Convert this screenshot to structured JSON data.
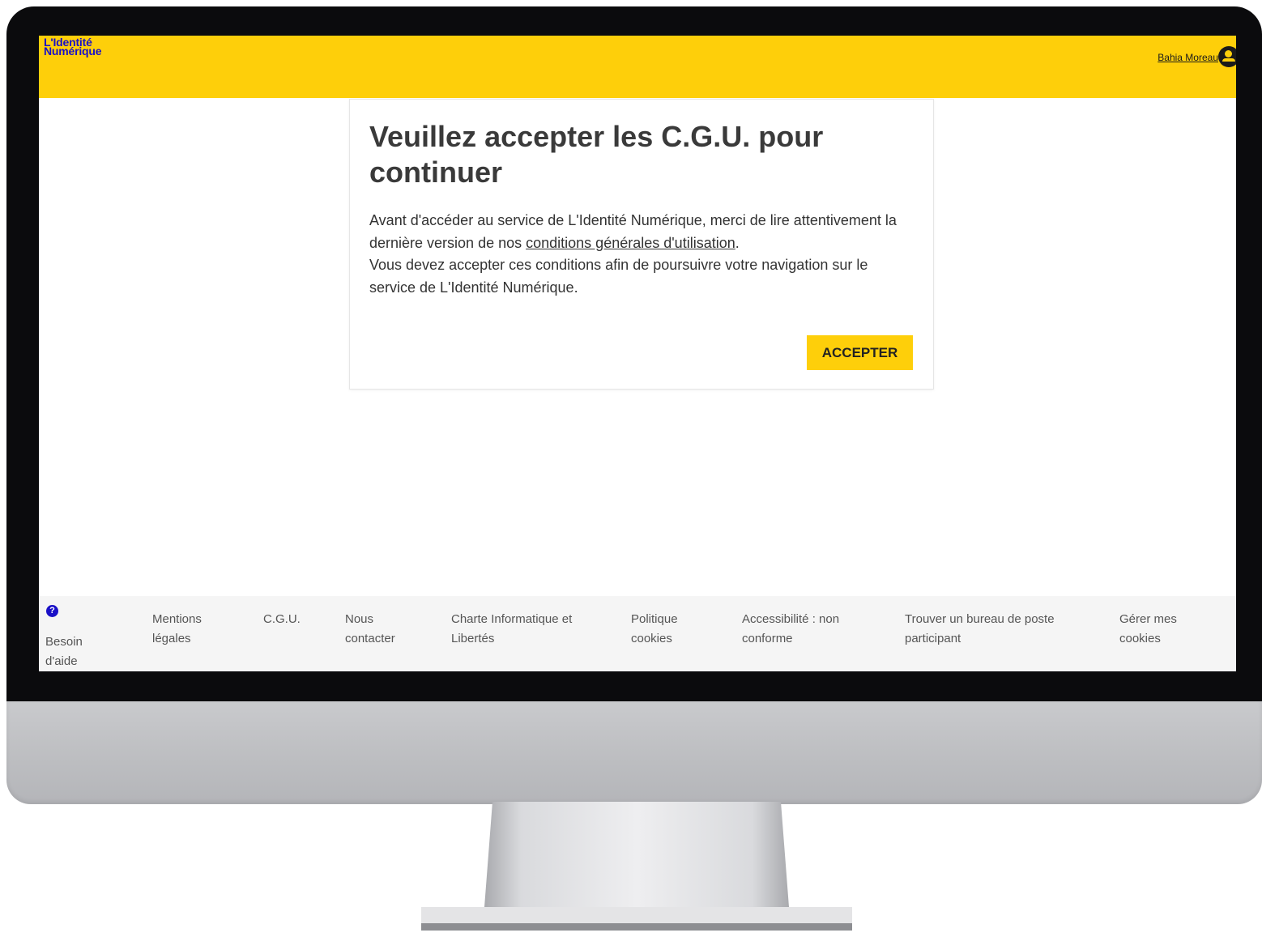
{
  "header": {
    "logo_line1": "L'Identité",
    "logo_line2": "Numérique",
    "user_name": "Bahia Moreau"
  },
  "modal": {
    "title": "Veuillez accepter les C.G.U. pour continuer",
    "p1_before": "Avant d'accéder au service de L'Identité Numérique, merci de lire attentivement la dernière version de nos ",
    "p1_link": "conditions générales d'utilisation",
    "p1_after": ".",
    "p2": "Vous devez accepter ces conditions afin de poursuivre votre navigation sur le service de L'Identité Numérique.",
    "accept_label": "ACCEPTER"
  },
  "footer": {
    "help_icon": "?",
    "help_label": "Besoin d'aide",
    "links": [
      "Mentions légales",
      "C.G.U.",
      "Nous contacter",
      "Charte Informatique et Libertés",
      "Politique cookies",
      "Accessibilité : non conforme",
      "Trouver un bureau de poste participant",
      "Gérer mes cookies"
    ]
  },
  "colors": {
    "brand_yellow": "#fecf0a",
    "brand_blue": "#1a10c7",
    "bezel": "#0b0b0d"
  }
}
